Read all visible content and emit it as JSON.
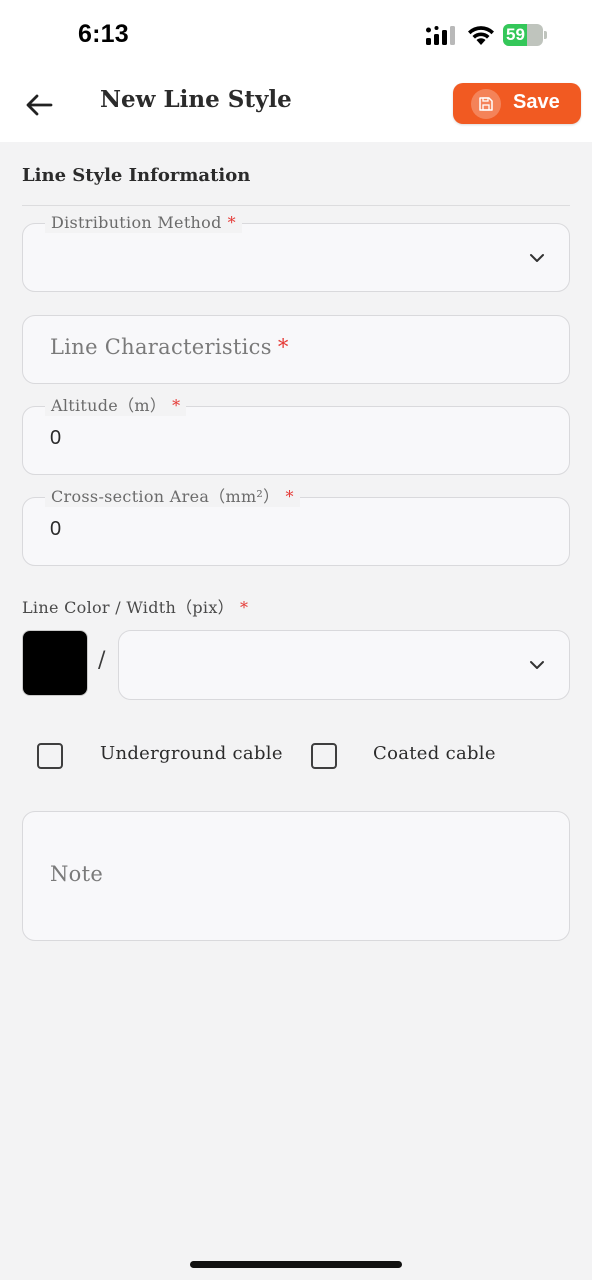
{
  "status_bar": {
    "time": "6:13",
    "battery_level": "59",
    "battery_fraction": 0.59,
    "battery_color": "#34c759",
    "icons": [
      "signal-icon",
      "wifi-icon",
      "battery-icon"
    ]
  },
  "header": {
    "title": "New Line Style",
    "back_icon": "arrow-left-icon",
    "save_label": "Save",
    "save_icon": "floppy-disk-icon",
    "accent_color": "#f15a22"
  },
  "form": {
    "section_title": "Line Style Information",
    "required_mark": "*",
    "distribution_method": {
      "label": "Distribution Method",
      "value": "",
      "icon": "chevron-down-icon"
    },
    "line_characteristics": {
      "placeholder": "Line Characteristics"
    },
    "altitude": {
      "label": "Altitude（m）",
      "value": "0"
    },
    "cross_section": {
      "label": "Cross-section Area（mm²）",
      "value": "0"
    },
    "line_color_width": {
      "label": "Line Color / Width（pix）",
      "separator": "/",
      "swatch_color": "#000000",
      "width_value": ""
    },
    "underground_cable": {
      "label": "Underground cable",
      "checked": false
    },
    "coated_cable": {
      "label": "Coated cable",
      "checked": false
    },
    "note": {
      "placeholder": "Note"
    }
  }
}
